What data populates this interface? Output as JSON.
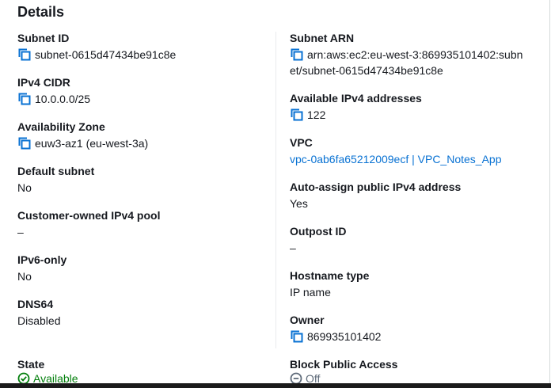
{
  "title": "Details",
  "left": [
    {
      "label": "Subnet ID",
      "value": "subnet-0615d47434be91c8e",
      "copy": true
    },
    {
      "label": "IPv4 CIDR",
      "value": "10.0.0.0/25",
      "copy": true
    },
    {
      "label": "Availability Zone",
      "value": "euw3-az1 (eu-west-3a)",
      "copy": true
    },
    {
      "label": "Default subnet",
      "value": "No"
    },
    {
      "label": "Customer-owned IPv4 pool",
      "value": "–"
    },
    {
      "label": "IPv6-only",
      "value": "No"
    },
    {
      "label": "DNS64",
      "value": "Disabled"
    },
    {
      "label": "State",
      "value": "Available",
      "status": "success"
    }
  ],
  "right": [
    {
      "label": "Subnet ARN",
      "value_line1": "arn:aws:ec2:eu-west-3:869935101402:subn",
      "value_line2": "et/subnet-0615d47434be91c8e",
      "copy": true
    },
    {
      "label": "Available IPv4 addresses",
      "value": "122",
      "copy": true
    },
    {
      "label": "VPC",
      "value": "vpc-0ab6fa65212009ecf | VPC_Notes_App",
      "link": true
    },
    {
      "label": "Auto-assign public IPv4 address",
      "value": "Yes"
    },
    {
      "label": "Outpost ID",
      "value": "–"
    },
    {
      "label": "Hostname type",
      "value": "IP name"
    },
    {
      "label": "Owner",
      "value": "869935101402",
      "copy": true
    },
    {
      "label": "Block Public Access",
      "value": "Off",
      "status": "off"
    }
  ],
  "colors": {
    "link": "#0972d3",
    "success": "#037f0c",
    "muted": "#5f6b7a"
  },
  "icons": {
    "copy": "copy-icon",
    "success": "check-circle-icon",
    "off": "minus-circle-icon"
  }
}
